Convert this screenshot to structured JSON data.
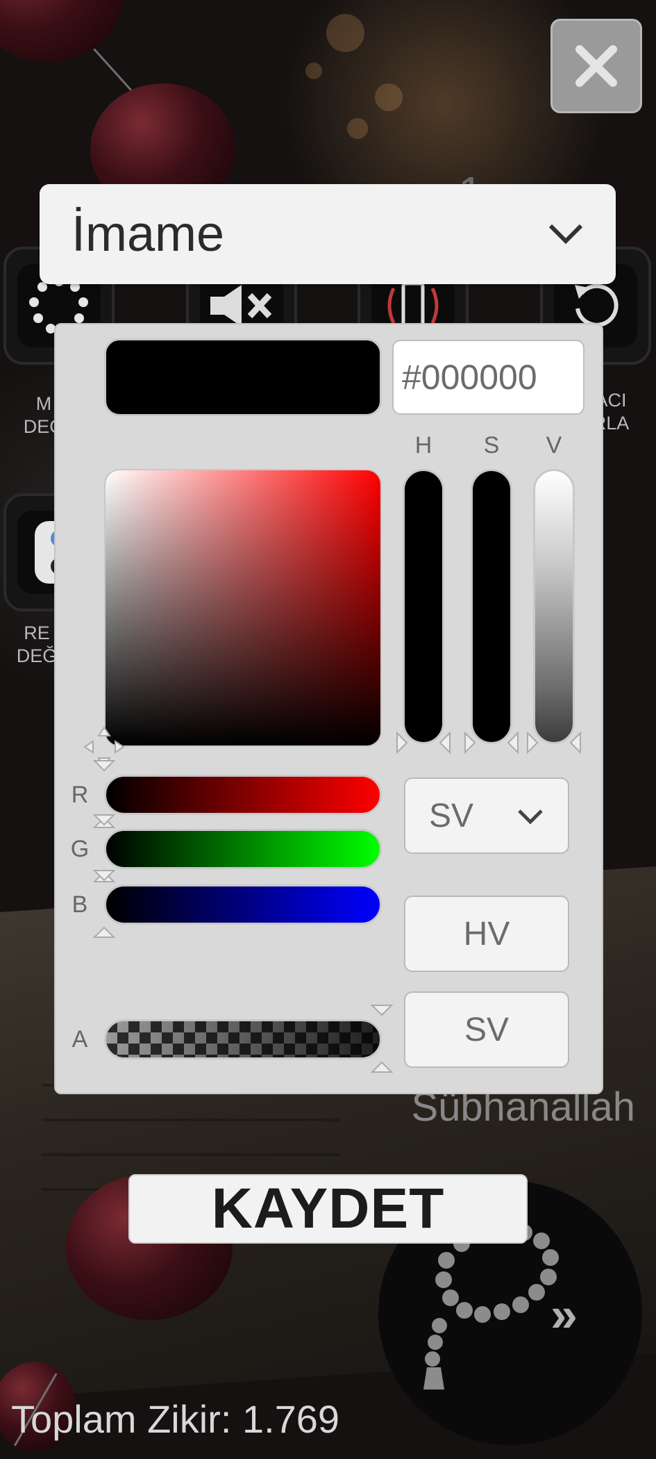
{
  "background": {
    "counter_text": "1",
    "captions": {
      "left_top": "M\nDEĞ",
      "right_top": "ACI\nRLA",
      "left_mid": "RE\nDEĞ"
    },
    "dhikr_name": "Sübhanallah",
    "total_label": "Toplam Zikir: 1.769",
    "forward_glyph": "»"
  },
  "close_button": {
    "icon": "close-icon"
  },
  "dropdown": {
    "selected": "İmame",
    "icon": "chevron-down-icon"
  },
  "color_picker": {
    "hex_value": "#000000",
    "current_color": "#000000",
    "hue_color": "#ff0000",
    "columns": {
      "h": "H",
      "s": "S",
      "v": "V"
    },
    "rows": {
      "r": "R",
      "g": "G",
      "b": "B",
      "a": "A"
    },
    "mode_select": {
      "selected": "SV",
      "icon": "chevron-down-icon"
    },
    "buttons": {
      "hv": "HV",
      "sv": "SV"
    }
  },
  "save_button": {
    "label": "KAYDET"
  }
}
